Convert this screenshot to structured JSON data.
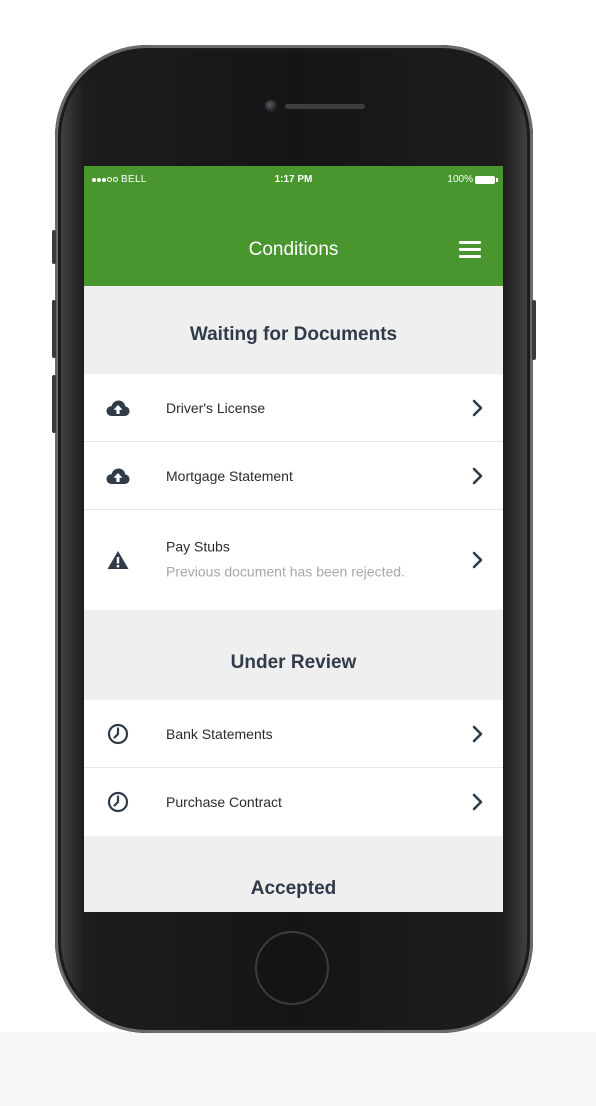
{
  "status_bar": {
    "carrier": "BELL",
    "time": "1:17 PM",
    "battery": "100%"
  },
  "header": {
    "title": "Conditions",
    "menu_icon": "hamburger-menu-icon"
  },
  "colors": {
    "header_green": "#4a962e",
    "section_bg": "#efefef",
    "section_text": "#2f3b49",
    "row_bg": "#ffffff",
    "subtext": "#a8a8a8"
  },
  "sections": [
    {
      "title": "Waiting for Documents",
      "items": [
        {
          "label": "Driver's License",
          "icon": "cloud-upload-icon"
        },
        {
          "label": "Mortgage Statement",
          "icon": "cloud-upload-icon"
        },
        {
          "label": "Pay Stubs",
          "sublabel": "Previous document has been rejected.",
          "icon": "warning-icon"
        }
      ]
    },
    {
      "title": "Under Review",
      "items": [
        {
          "label": "Bank Statements",
          "icon": "clock-icon"
        },
        {
          "label": "Purchase Contract",
          "icon": "clock-icon"
        }
      ]
    },
    {
      "title": "Accepted",
      "items": []
    }
  ]
}
